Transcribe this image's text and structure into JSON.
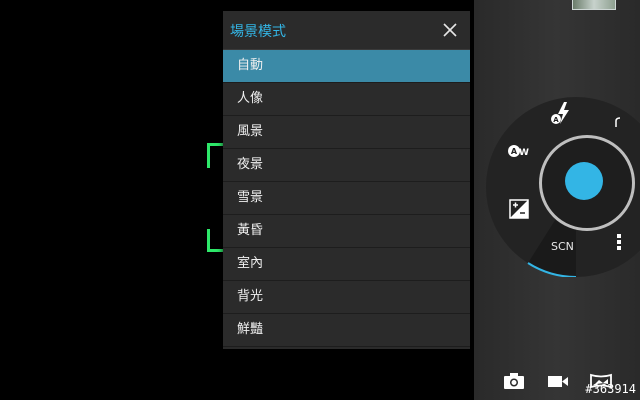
{
  "scene_dialog": {
    "title": "場景模式",
    "close_icon": "close-icon",
    "selected_index": 0,
    "items": [
      {
        "label": "自動"
      },
      {
        "label": "人像"
      },
      {
        "label": "風景"
      },
      {
        "label": "夜景"
      },
      {
        "label": "雪景"
      },
      {
        "label": "黃昏"
      },
      {
        "label": "室內"
      },
      {
        "label": "背光"
      },
      {
        "label": "鮮豔"
      }
    ]
  },
  "dial": {
    "active_mode_label": "SCN",
    "icons": [
      "flash-auto-icon",
      "white-balance-auto-icon",
      "exposure-icon",
      "more-icon",
      "settings-arc-icon"
    ]
  },
  "bottom_bar": {
    "icons": [
      "camera-icon",
      "video-icon",
      "panorama-icon"
    ]
  },
  "watermark": "#363914",
  "colors": {
    "accent": "#33b5e5",
    "selected_row": "#3b8aa7",
    "focus_green": "#2ee86a"
  }
}
